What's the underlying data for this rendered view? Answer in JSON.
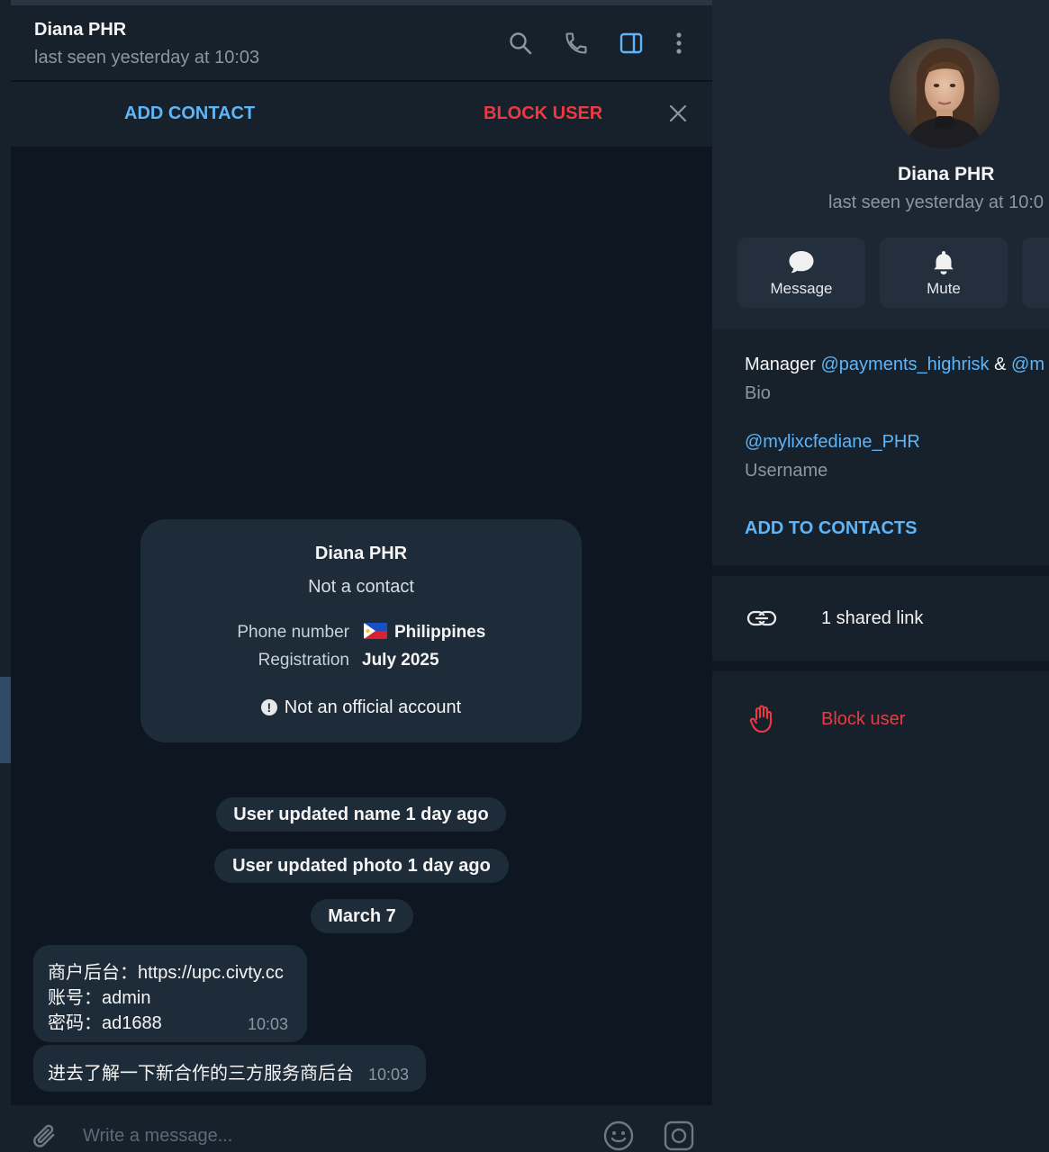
{
  "chat": {
    "title": "Diana PHR",
    "status": "last seen yesterday at 10:03",
    "actions": {
      "add_contact": "ADD CONTACT",
      "block_user": "BLOCK USER"
    },
    "info_card": {
      "name": "Diana PHR",
      "subtitle": "Not a contact",
      "phone_label": "Phone number",
      "phone_value": "Philippines",
      "registration_label": "Registration",
      "registration_value": "July 2025",
      "warning": "Not an official account"
    },
    "service_messages": [
      "User updated name 1 day ago",
      "User updated photo 1 day ago",
      "March 7"
    ],
    "messages": [
      {
        "lines": [
          "商户后台：https://upc.civty.cc",
          "账号：admin",
          "密码：ad1688"
        ],
        "time": "10:03"
      },
      {
        "lines": [
          "进去了解一下新合作的三方服务商后台"
        ],
        "time": "10:03"
      }
    ],
    "composer": {
      "placeholder": "Write a message..."
    }
  },
  "profile": {
    "name": "Diana PHR",
    "status": "last seen yesterday at 10:0",
    "buttons": [
      {
        "label": "Message"
      },
      {
        "label": "Mute"
      }
    ],
    "bio": {
      "prefix": "Manager ",
      "mention1": "@payments_highrisk",
      "joiner": " & ",
      "mention2": "@m",
      "label": "Bio"
    },
    "username": {
      "value": "@mylixcfediane_PHR",
      "label": "Username"
    },
    "add_to_contacts": "ADD TO CONTACTS",
    "shared_links": "1 shared link",
    "block_user": "Block user"
  },
  "colors": {
    "accent": "#5eb5f7",
    "danger": "#ec3942",
    "chat_bg": "#0e1621",
    "panel_bg": "#17212b",
    "bubble_bg": "#1e2c3a"
  },
  "icons": {
    "header": [
      "search-icon",
      "phone-icon",
      "sidebar-toggle-icon",
      "more-vertical-icon"
    ],
    "composer": [
      "attach-icon",
      "emoji-icon",
      "camera-icon"
    ],
    "profile": [
      "message-icon",
      "bell-icon",
      "link-icon",
      "hand-stop-icon"
    ]
  }
}
